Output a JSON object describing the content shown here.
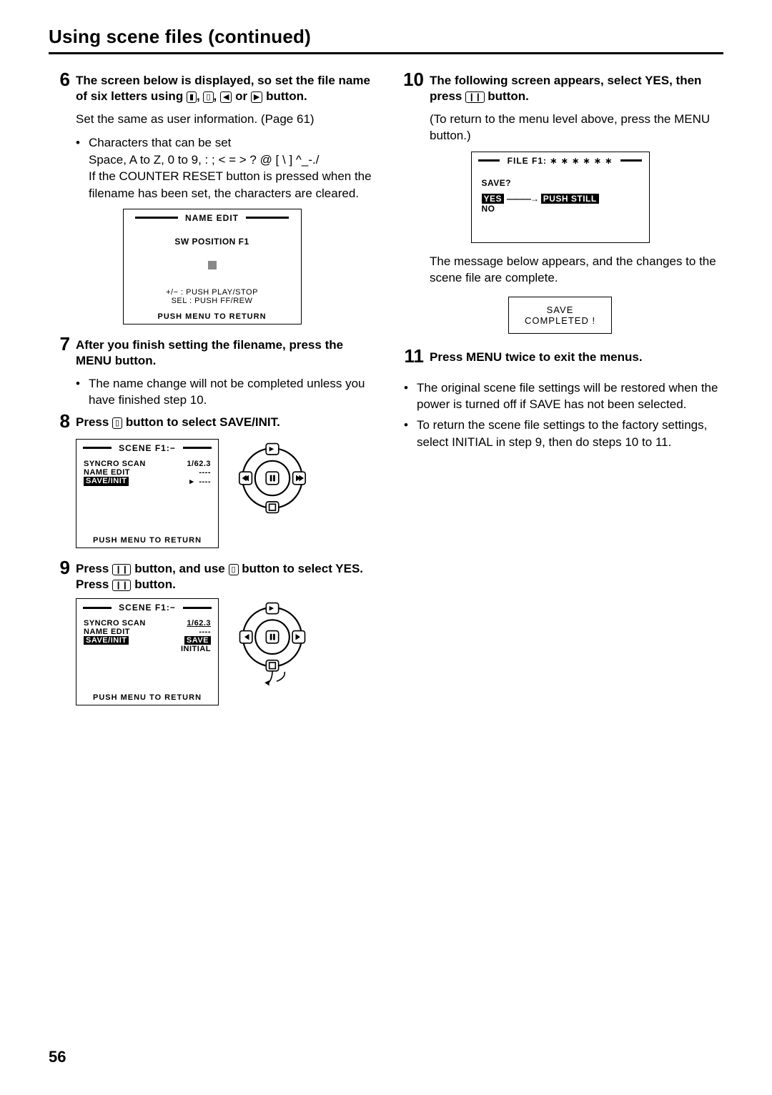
{
  "title": "Using scene files (continued)",
  "page_number": "56",
  "icons": {
    "rew": "▯",
    "stop": "▯",
    "ff": "▯",
    "pause": "❙❙"
  },
  "left": {
    "s6": {
      "num": "6",
      "head_a": "The screen below is displayed, so set the file name of six letters using ",
      "head_b": " or ",
      "head_c": " button.",
      "body1": "Set the same as user information. (Page 61)",
      "bul1": "Characters that can be set",
      "line_chars": "Space, A to Z, 0 to 9, : ; < = > ?  @  [ \\ ] ^_-./",
      "line_reset": "If the COUNTER RESET button is pressed when the filename has been set, the characters are cleared.",
      "lcd": {
        "hdr": "NAME  EDIT",
        "line1": "SW  POSITION  F1",
        "line2_square": true,
        "help1": "+/−  : PUSH  PLAY/STOP",
        "help2": "SEL : PUSH  FF/REW",
        "foot": "PUSH  MENU  TO  RETURN"
      }
    },
    "s7": {
      "num": "7",
      "head": "After you finish setting the filename, press the MENU button.",
      "bul": "The name change will not be completed unless you have finished step 10."
    },
    "s8": {
      "num": "8",
      "head_a": "Press ",
      "head_b": " button to select SAVE/INIT.",
      "lcd": {
        "hdr": "SCENE  F1:−",
        "r1a": "SYNCRO SCAN",
        "r1b": "1/62.3",
        "r2a": "NAME  EDIT",
        "r2b": "----",
        "r3a": "SAVE/INIT",
        "r3b": "----",
        "foot": "PUSH  MENU  TO  RETURN"
      }
    },
    "s9": {
      "num": "9",
      "head_a": "Press ",
      "head_b": " button, and use ",
      "head_c": " button to select YES. Press ",
      "head_d": " button.",
      "lcd": {
        "hdr": "SCENE  F1:−",
        "r1a": "SYNCRO SCAN",
        "r1b": "1/62.3",
        "r2a": "NAME  EDIT",
        "r2b": "----",
        "r3a": "SAVE/INIT",
        "r3b_sel": "SAVE",
        "r4b": "INITIAL",
        "foot": "PUSH  MENU  TO  RETURN"
      }
    }
  },
  "right": {
    "s10": {
      "num": "10",
      "head_a": "The following screen appears, select YES, then press ",
      "head_b": " button.",
      "body": "(To return to the menu level above, press the MENU button.)",
      "lcd": {
        "hdr": "FILE  F1:  ∗ ∗ ∗ ∗ ∗ ∗",
        "line1": "SAVE?",
        "yes": "YES",
        "arrow": "———→",
        "push": "PUSH  STILL",
        "no": "NO"
      },
      "after": "The message below appears, and the changes to the scene file are complete.",
      "done1": "SAVE",
      "done2": "COMPLETED !"
    },
    "s11": {
      "num": "11",
      "head": "Press MENU twice to exit the menus."
    },
    "notes": {
      "b1": "The original scene file settings will be restored when the power is turned off if SAVE has not been selected.",
      "b2": "To return the scene file settings to the factory settings, select INITIAL in step 9, then do steps 10 to 11."
    }
  }
}
